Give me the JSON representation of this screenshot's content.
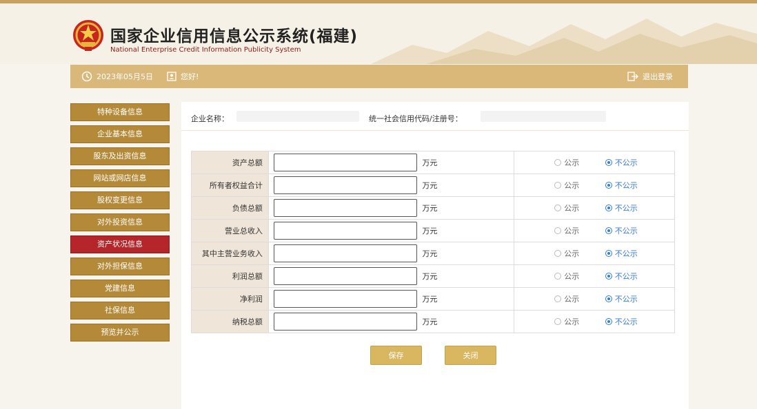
{
  "header": {
    "title": "国家企业信用信息公示系统(福建)",
    "subtitle": "National Enterprise Credit Information Publicity System"
  },
  "toolbar": {
    "date": "2023年05月5日",
    "user": "您好!",
    "logout": "退出登录"
  },
  "sidebar": {
    "active_index": 6,
    "items": [
      {
        "label": "特种设备信息"
      },
      {
        "label": "企业基本信息"
      },
      {
        "label": "股东及出资信息"
      },
      {
        "label": "网站或网店信息"
      },
      {
        "label": "股权变更信息"
      },
      {
        "label": "对外投资信息"
      },
      {
        "label": "资产状况信息"
      },
      {
        "label": "对外担保信息"
      },
      {
        "label": "党建信息"
      },
      {
        "label": "社保信息"
      },
      {
        "label": "预览并公示"
      }
    ]
  },
  "info": {
    "company_label": "企业名称：",
    "code_label": "统一社会信用代码/注册号："
  },
  "form": {
    "unit": "万元",
    "public_label": "公示",
    "private_label": "不公示",
    "rows": [
      {
        "label": "资产总额",
        "value": "",
        "selected": "private"
      },
      {
        "label": "所有者权益合计",
        "value": "",
        "selected": "private"
      },
      {
        "label": "负债总额",
        "value": "",
        "selected": "private"
      },
      {
        "label": "营业总收入",
        "value": "",
        "selected": "private"
      },
      {
        "label": "其中主营业务收入",
        "value": "",
        "selected": "private"
      },
      {
        "label": "利润总额",
        "value": "",
        "selected": "private"
      },
      {
        "label": "净利润",
        "value": "",
        "selected": "private"
      },
      {
        "label": "纳税总额",
        "value": "",
        "selected": "private"
      }
    ]
  },
  "buttons": {
    "save": "保存",
    "close": "关闭"
  },
  "colors": {
    "gold": "#d9b87a",
    "sidebar": "#b48a39",
    "active": "#b4262a",
    "radio": "#2f7de0"
  }
}
